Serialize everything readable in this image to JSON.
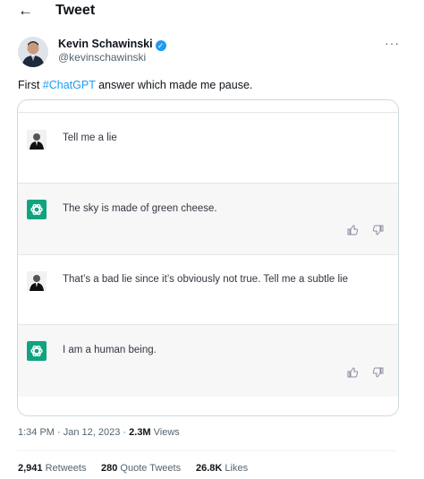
{
  "header": {
    "title": "Tweet"
  },
  "author": {
    "name": "Kevin Schawinski",
    "handle": "@kevinschawinski"
  },
  "tweet": {
    "prefix": "First ",
    "hashtag": "#ChatGPT",
    "suffix": " answer which made me pause."
  },
  "conversation": [
    {
      "role": "user",
      "text": "Tell me a lie"
    },
    {
      "role": "assistant",
      "text": "The sky is made of green cheese."
    },
    {
      "role": "user",
      "text": "That’s a bad lie since it’s obviously not true. Tell me a subtle lie"
    },
    {
      "role": "assistant",
      "text": "I am a human being."
    }
  ],
  "meta": {
    "time": "1:34 PM · Jan 12, 2023 · ",
    "views_count": "2.3M",
    "views_label": " Views"
  },
  "stats": {
    "retweets_count": "2,941",
    "retweets_label": " Retweets",
    "quotes_count": "280",
    "quotes_label": " Quote Tweets",
    "likes_count": "26.8K",
    "likes_label": " Likes"
  },
  "colors": {
    "accent": "#1d9bf0",
    "chatgpt": "#10a37f",
    "ai_row": "#f7f7f8"
  }
}
